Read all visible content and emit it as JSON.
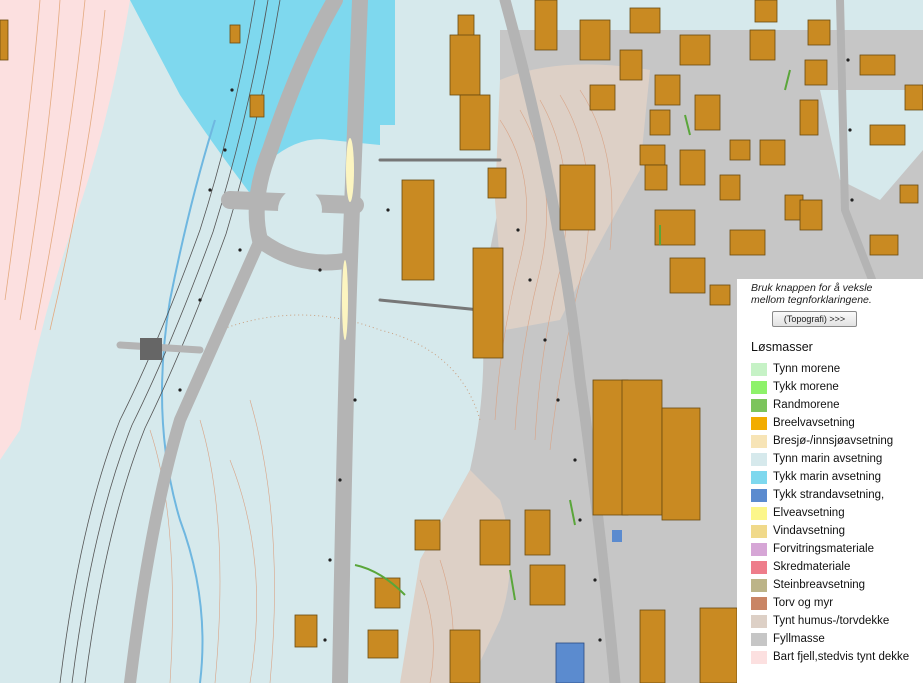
{
  "legend": {
    "hint": [
      "Bruk knappen for å veksle",
      "mellom tegnforklaringene."
    ],
    "toggle_label": "(Topografi) >>>",
    "title": "Løsmasser",
    "items": [
      {
        "label": "Tynn morene",
        "color": "#c6f2c6"
      },
      {
        "label": "Tykk morene",
        "color": "#8ef26a"
      },
      {
        "label": "Randmorene",
        "color": "#7cc45c"
      },
      {
        "label": "Breelvavsetning",
        "color": "#f2ac00"
      },
      {
        "label": "Bresjø-/innsjøavsetning",
        "color": "#f7e4b6"
      },
      {
        "label": "Tynn marin avsetning",
        "color": "#d6e9ec"
      },
      {
        "label": "Tykk marin avsetning",
        "color": "#7ed8ee"
      },
      {
        "label": "Tykk strandavsetning,",
        "color": "#5b8bcf"
      },
      {
        "label": "Elveavsetning",
        "color": "#fcf68a"
      },
      {
        "label": "Vindavsetning",
        "color": "#f0d98a"
      },
      {
        "label": "Forvitringsmateriale",
        "color": "#d6a6d6"
      },
      {
        "label": "Skredmateriale",
        "color": "#ee7d8b"
      },
      {
        "label": "Steinbreavsetning",
        "color": "#bcb488"
      },
      {
        "label": "Torv og myr",
        "color": "#c98565"
      },
      {
        "label": "Tynt humus-/torvdekke",
        "color": "#ddd0c6"
      },
      {
        "label": "Fyllmasse",
        "color": "#c6c6c6"
      },
      {
        "label": "Bart fjell,stedvis tynt dekke",
        "color": "#fce0e0"
      }
    ]
  },
  "map_colors": {
    "marine_thin": "#d6e9ec",
    "marine_thick": "#7ed8ee",
    "bedrock": "#fce0e0",
    "fill": "#c6c6c6",
    "humus": "#ddd0c6",
    "road": "#b4b4b4",
    "building": "#c98a22"
  }
}
